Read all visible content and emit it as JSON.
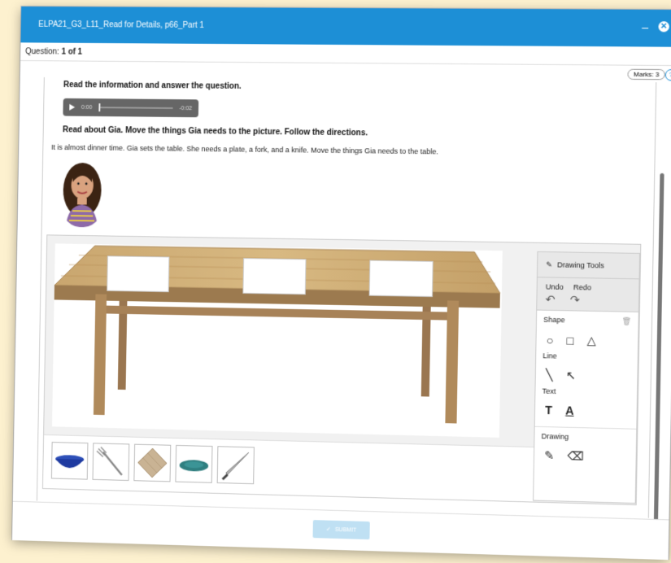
{
  "window": {
    "title": "ELPA21_G3_L11_Read for Details, p66_Part 1",
    "minimize_label": "–",
    "close_label": "✕"
  },
  "question": {
    "label": "Question:",
    "value": "1 of 1",
    "marks": "Marks: 3",
    "help": "?"
  },
  "content": {
    "instruction": "Read the information and answer the question.",
    "audio_current": "0:00",
    "audio_remaining": "-0:02",
    "prompt": "Read about Gia. Move the things Gia needs to the picture. Follow the directions.",
    "passage": "It is almost dinner time. Gia sets the table. She needs a plate, a fork, and a knife. Move the things Gia needs to the table."
  },
  "drawing_tools": {
    "header": "Drawing Tools",
    "undo": "Undo",
    "redo": "Redo",
    "shape": "Shape",
    "line": "Line",
    "text": "Text",
    "drawing": "Drawing",
    "text_tool_glyph": "T",
    "text_underline_glyph": "A"
  },
  "tray": {
    "items": [
      "bowl-icon",
      "fork-icon",
      "napkin-icon",
      "plate-icon",
      "knife-icon"
    ]
  },
  "submit": {
    "label": "SUBMIT"
  },
  "colors": {
    "titlebar": "#1d8fd6",
    "submit_disabled": "#bfe0f3",
    "background": "#fdf1cf"
  }
}
